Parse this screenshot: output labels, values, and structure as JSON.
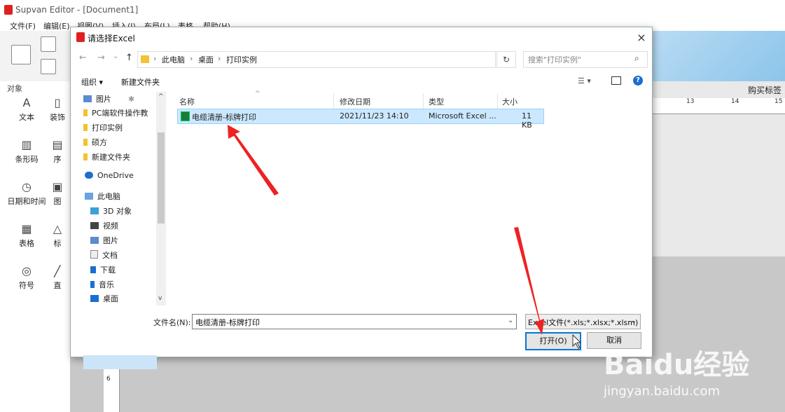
{
  "app": {
    "title": "Supvan Editor - [Document1]",
    "menu": [
      "文件(F)",
      "编辑(E)",
      "视图(V)",
      "插入(I)",
      "布局(L)",
      "表格",
      "帮助(H)"
    ],
    "left_header": "对象",
    "tools": [
      "文本",
      "装饰",
      "条形码",
      "序",
      "日期和时间",
      "图",
      "表格",
      "标",
      "符号",
      "直"
    ],
    "buy_label": "购买标签",
    "ruler_ticks": [
      "13",
      "14",
      "15"
    ],
    "vruler_tick": "6"
  },
  "dialog": {
    "title": "请选择Excel",
    "close": "×",
    "nav": {
      "back": "←",
      "forward": "→",
      "down": "⌄",
      "up": "↑"
    },
    "breadcrumb": [
      "此电脑",
      "桌面",
      "打印实例"
    ],
    "refresh": "↻",
    "search_placeholder": "搜索\"打印实例\"",
    "commands": {
      "organize": "组织 ▾",
      "new_folder": "新建文件夹"
    },
    "nav_items": [
      "图片",
      "PC端软件操作教",
      "打印实例",
      "硕方",
      "新建文件夹",
      "OneDrive",
      "此电脑",
      "3D 对象",
      "视频",
      "图片",
      "文档",
      "下载",
      "音乐",
      "桌面"
    ],
    "columns": {
      "name": "名称",
      "date": "修改日期",
      "type": "类型",
      "size": "大小"
    },
    "file": {
      "name": "电缆清册-标牌打印",
      "date": "2021/11/23 14:10",
      "type": "Microsoft Excel ...",
      "size": "11 KB"
    },
    "filename_label": "文件名(N):",
    "filename_value": "电缆清册-标牌打印",
    "filter_value": "Excel文件(*.xls;*.xlsx;*.xlsm)",
    "open_button": "打开(O)",
    "cancel_button": "取消"
  },
  "watermark": {
    "brand": "Baidu经验",
    "url": "jingyan.baidu.com"
  },
  "colors": {
    "accent": "#0078d7",
    "selection": "#cce8ff",
    "arrow": "#ee2222"
  }
}
